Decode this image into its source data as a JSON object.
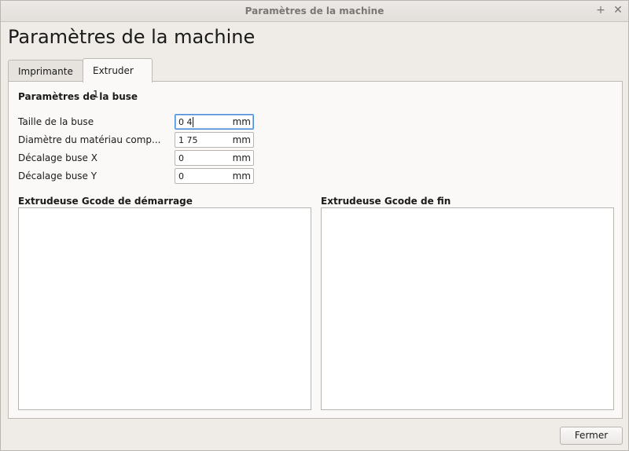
{
  "window": {
    "title": "Paramètres de la machine",
    "pin_symbol": "+",
    "close_symbol": "✕"
  },
  "page": {
    "title": "Paramètres de la machine"
  },
  "tabs": [
    {
      "label": "Imprimante",
      "active": false
    },
    {
      "label": "Extruder 1",
      "active": true
    }
  ],
  "nozzle_section": {
    "title": "Paramètres de la buse",
    "fields": [
      {
        "label": "Taille de la buse",
        "value": "0 4",
        "unit": "mm"
      },
      {
        "label": "Diamètre du matériau comp...",
        "value": "1 75",
        "unit": "mm"
      },
      {
        "label": "Décalage buse X",
        "value": "0",
        "unit": "mm"
      },
      {
        "label": "Décalage buse Y",
        "value": "0",
        "unit": "mm"
      }
    ]
  },
  "gcode": {
    "start_title": "Extrudeuse Gcode de démarrage",
    "start_content": "",
    "end_title": "Extrudeuse Gcode de fin",
    "end_content": ""
  },
  "footer": {
    "close_label": "Fermer"
  },
  "colors": {
    "background": "#efebe7",
    "panel": "#fbf9f7",
    "focus": "#4a90d9"
  }
}
